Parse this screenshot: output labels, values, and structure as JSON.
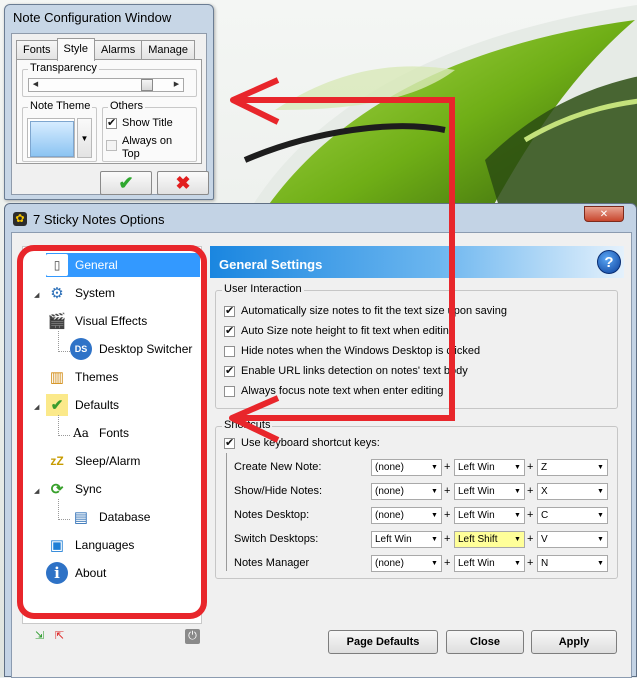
{
  "note_window": {
    "title": "Note Configuration Window",
    "tabs": [
      "Fonts",
      "Style",
      "Alarms",
      "Manage"
    ],
    "active_tab": "Style",
    "transparency_label": "Transparency",
    "transparency_level": 0.85,
    "note_theme_label": "Note Theme",
    "others_label": "Others",
    "show_title_label": "Show Title",
    "show_title_checked": true,
    "always_on_top_label": "Always on Top",
    "always_on_top_checked": false,
    "ok_icon": "check-icon",
    "cancel_icon": "x-icon"
  },
  "main_window": {
    "title": "7 Sticky Notes Options",
    "close_icon": "close-icon",
    "nav": [
      {
        "label": "General",
        "icon": "phone-icon",
        "selected": true
      },
      {
        "label": "System",
        "icon": "gears-icon"
      },
      {
        "label": "Visual Effects",
        "icon": "clapper-icon"
      },
      {
        "label": "Desktop Switcher",
        "icon": "ds-icon"
      },
      {
        "label": "Themes",
        "icon": "books-icon"
      },
      {
        "label": "Defaults",
        "icon": "note-check-icon"
      },
      {
        "label": "Fonts",
        "icon": "fonts-icon"
      },
      {
        "label": "Sleep/Alarm",
        "icon": "sleep-icon"
      },
      {
        "label": "Sync",
        "icon": "sync-icon"
      },
      {
        "label": "Database",
        "icon": "database-icon"
      },
      {
        "label": "Languages",
        "icon": "languages-icon"
      },
      {
        "label": "About",
        "icon": "info-icon"
      }
    ],
    "header": "General Settings",
    "help_icon": "help-icon",
    "user_interaction": {
      "legend": "User Interaction",
      "options": [
        {
          "label": "Automatically size notes to fit the text size upon saving",
          "checked": true
        },
        {
          "label": "Auto Size note height to fit text when editing",
          "checked": true
        },
        {
          "label": "Hide notes when the Windows Desktop is clicked",
          "checked": false
        },
        {
          "label": "Enable URL links detection on notes' text body",
          "checked": true
        },
        {
          "label": "Always focus note text when enter editing",
          "checked": false
        }
      ]
    },
    "shortcuts": {
      "legend": "Shortcuts",
      "use_label": "Use keyboard shortcut keys:",
      "use_checked": true,
      "rows": [
        {
          "label": "Create New Note:",
          "mod1": "(none)",
          "mod2": "Left Win",
          "key": "Z",
          "sep": "+"
        },
        {
          "label": "Show/Hide Notes:",
          "mod1": "(none)",
          "mod2": "Left Win",
          "key": "X",
          "sep": "+"
        },
        {
          "label": "Notes Desktop:",
          "mod1": "(none)",
          "mod2": "Left Win",
          "key": "C",
          "sep": "+"
        },
        {
          "label": "Switch Desktops:",
          "mod1": "Left Win",
          "mod2": "Left Shift",
          "key": "V",
          "sep": "+"
        },
        {
          "label": "Notes Manager",
          "mod1": "(none)",
          "mod2": "Left Win",
          "key": "N",
          "sep": "+"
        }
      ]
    },
    "buttons": {
      "page_defaults": "Page Defaults",
      "close": "Close",
      "apply": "Apply"
    }
  },
  "colors": {
    "selection": "#3399ff",
    "annotation": "#e8262b",
    "header_blue": "#1a86e0"
  }
}
